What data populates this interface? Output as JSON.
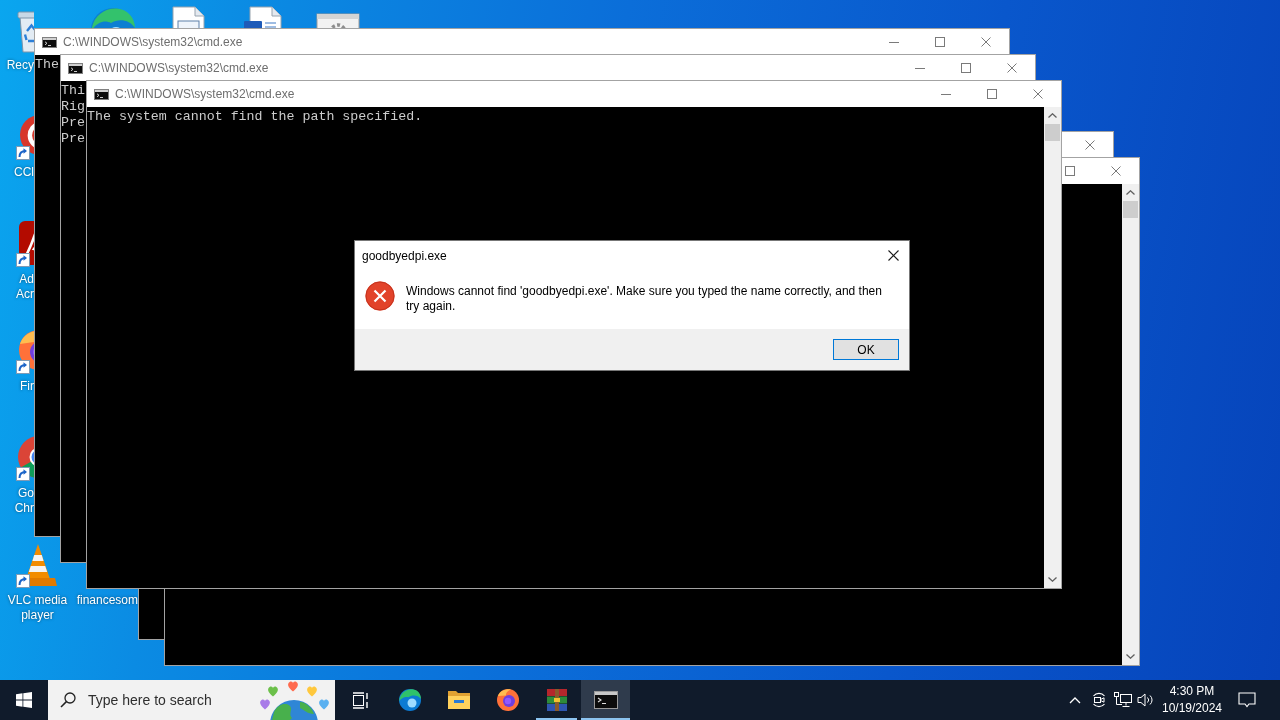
{
  "desktop": {
    "icons": [
      {
        "kind": "recycle-bin",
        "label_lines": [
          "Recy"
        ]
      },
      {
        "kind": "edge"
      },
      {
        "kind": "document"
      },
      {
        "kind": "word-document"
      },
      {
        "kind": "settings-file"
      },
      {
        "kind": "ccleaner",
        "label_lines": [
          "CCl"
        ]
      },
      {
        "kind": "acrobat",
        "label_lines": [
          "Ad",
          "Acr"
        ]
      },
      {
        "kind": "firefox",
        "label_lines": [
          "Fir"
        ]
      },
      {
        "kind": "chrome",
        "label_lines": [
          "Go",
          "Chr"
        ]
      },
      {
        "kind": "vlc",
        "label_lines": [
          "VLC media",
          "player"
        ]
      },
      {
        "label_lines": [
          "financesom"
        ]
      }
    ]
  },
  "windows": [
    {
      "kind": "console",
      "title": "C:\\WINDOWS\\system32\\cmd.exe",
      "lines": [
        "The"
      ]
    },
    {
      "kind": "console",
      "title": "C:\\WINDOWS\\system32\\cmd.exe",
      "lines": [
        "Thi",
        "Rig",
        "Pre",
        "Pre"
      ]
    },
    {
      "kind": "console",
      "title": "C:\\WINDOWS\\system32\\cmd.exe",
      "lines": [
        "The system cannot find the path specified."
      ]
    },
    {
      "kind": "console"
    },
    {
      "kind": "console"
    }
  ],
  "dialog": {
    "kind": "error",
    "title": "goodbyedpi.exe",
    "message": "Windows cannot find 'goodbyedpi.exe'. Make sure you typed the name correctly, and then try again.",
    "buttons": [
      {
        "label": "OK",
        "focused": true
      }
    ]
  },
  "taskbar": {
    "search": {
      "placeholder": "Type here to search"
    },
    "apps": [
      {
        "kind": "edge",
        "running": false,
        "selected": false
      },
      {
        "kind": "file-explorer",
        "running": false,
        "selected": false
      },
      {
        "kind": "firefox",
        "running": false,
        "selected": false
      },
      {
        "kind": "winrar",
        "running": true,
        "selected": false
      },
      {
        "kind": "cmd",
        "running": true,
        "selected": true
      }
    ],
    "clock": {
      "time": "4:30 PM",
      "date": "10/19/2024"
    }
  }
}
